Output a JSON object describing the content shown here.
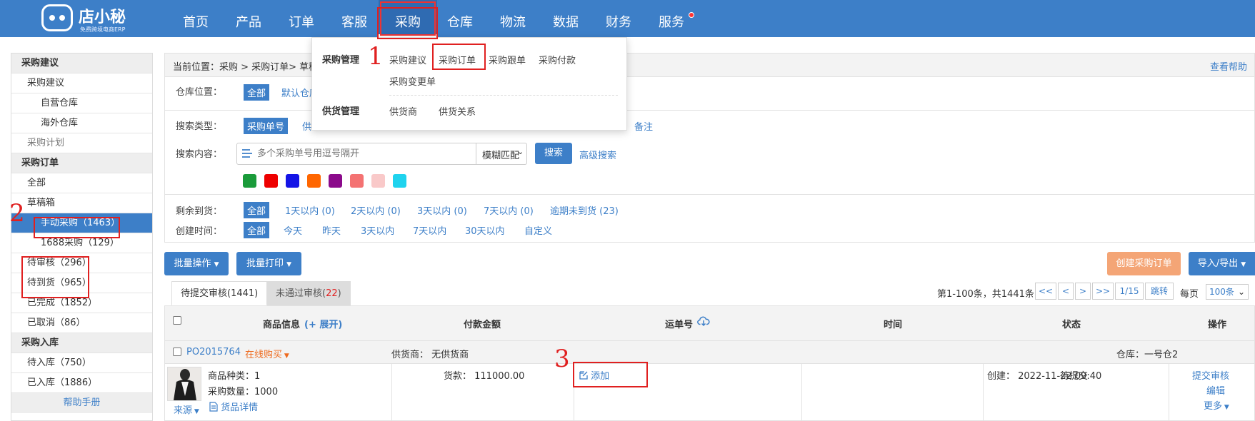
{
  "topnav": {
    "brand": "店小秘",
    "brand_sub": "免费跨境电商ERP",
    "items": [
      "首页",
      "产品",
      "订单",
      "客服",
      "采购",
      "仓库",
      "物流",
      "数据",
      "财务",
      "服务"
    ]
  },
  "dropdown": {
    "group1": "采购管理",
    "group1_items": [
      "采购建议",
      "采购订单",
      "采购跟单",
      "采购付款",
      "采购变更单"
    ],
    "group2": "供货管理",
    "group2_items": [
      "供货商",
      "供货关系"
    ]
  },
  "annotations": [
    "1",
    "2",
    "3"
  ],
  "sidebar": {
    "rows": [
      {
        "text": "采购建议",
        "type": "head"
      },
      {
        "text": "采购建议",
        "type": "l1"
      },
      {
        "text": "自营仓库",
        "type": "l2"
      },
      {
        "text": "海外仓库",
        "type": "l2"
      },
      {
        "text": "采购计划",
        "type": "l1grey"
      },
      {
        "text": "采购订单",
        "type": "head"
      },
      {
        "text": "全部",
        "type": "l1"
      },
      {
        "text": "草稿箱",
        "type": "l1"
      },
      {
        "text": "手动采购（1463）",
        "type": "active"
      },
      {
        "text": "1688采购（129）",
        "type": "l2"
      },
      {
        "text": "待审核（296）",
        "type": "l1"
      },
      {
        "text": "待到货（965）",
        "type": "l1"
      },
      {
        "text": "已完成（1852）",
        "type": "l1"
      },
      {
        "text": "已取消（86）",
        "type": "l1"
      },
      {
        "text": "采购入库",
        "type": "head"
      },
      {
        "text": "待入库（750）",
        "type": "l1"
      },
      {
        "text": "已入库（1886）",
        "type": "l1"
      },
      {
        "text": "帮助手册",
        "type": "help"
      }
    ]
  },
  "breadcrumb": {
    "text": "当前位置：采购 > 采购订单> 草稿箱",
    "help": "查看帮助"
  },
  "filters": {
    "warehouse_label": "仓库位置：",
    "warehouse_all": "全部",
    "warehouse_default": "默认仓库",
    "search_type_label": "搜索类型：",
    "search_type_active": "采购单号",
    "search_type_next": "供",
    "search_type_remark": "备注",
    "search_content_label": "搜索内容：",
    "search_placeholder": "多个采购单号用逗号隔开",
    "match_mode": "模糊匹配",
    "search_button": "搜索",
    "advanced_search": "高级搜索",
    "color_tags": [
      "#1a9b3a",
      "#ee0000",
      "#1414e6",
      "#ff6600",
      "#8b0a8b",
      "#f47272",
      "#f9c9c9",
      "#1fd3ee"
    ],
    "remaining_label": "剩余到货：",
    "remaining_all": "全部",
    "remaining_options": [
      "1天以内 (0)",
      "2天以内 (0)",
      "3天以内 (0)",
      "7天以内 (0)",
      "逾期未到货 (23)"
    ],
    "created_label": "创建时间：",
    "created_all": "全部",
    "created_options": [
      "今天",
      "昨天",
      "3天以内",
      "7天以内",
      "30天以内",
      "自定义"
    ]
  },
  "toolbar": {
    "batch_ops": "批量操作",
    "batch_print": "批量打印",
    "create_order": "创建采购订单",
    "import_export": "导入/导出"
  },
  "tabs": {
    "pending_label": "待提交审核",
    "pending_count": "(1441)",
    "rejected_label": "未通过审核",
    "rejected_count": "22"
  },
  "pager": {
    "summary": "第1-100条，共1441条",
    "buttons": [
      "<<",
      "<",
      ">",
      ">>"
    ],
    "page": "1/15",
    "jump": "跳转",
    "per_page_label": "每页",
    "per_page": "100条"
  },
  "table": {
    "headers": {
      "product": "商品信息",
      "expand": "(+ 展开)",
      "amount": "付款金额",
      "tracking": "运单号",
      "time": "时间",
      "status": "状态",
      "actions": "操作"
    },
    "order": {
      "po": "PO2015764",
      "source_tag": "在线购买",
      "supplier": "供货商：  无供货商",
      "warehouse": "仓库：一号仓2",
      "kinds": "商品种类：1",
      "quantity": "采购数量：1000",
      "source_link": "来源",
      "detail_link": "货品详情",
      "goods_amount": "货款：  111000.00",
      "tracking_add": "添加",
      "created": "创建：  2022-11-22 09:40",
      "status": "待提交",
      "act_submit": "提交审核",
      "act_edit": "编辑",
      "act_more": "更多"
    }
  }
}
